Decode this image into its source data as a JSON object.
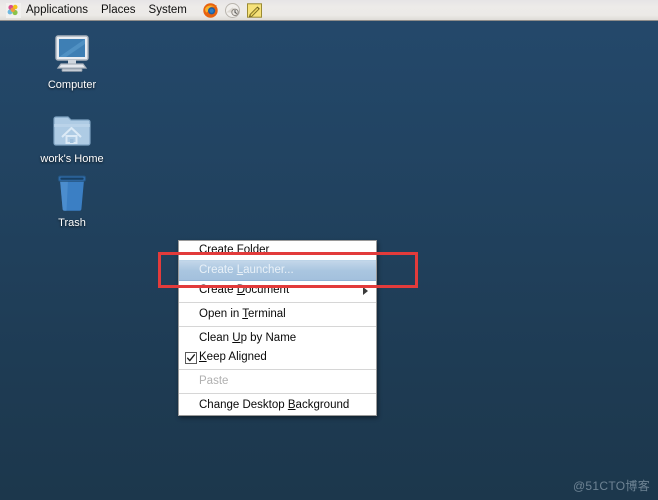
{
  "panel": {
    "apps_icon": "gnome-foot-icon",
    "menus": [
      {
        "label": "Applications"
      },
      {
        "label": "Places"
      },
      {
        "label": "System"
      }
    ],
    "launchers": [
      {
        "name": "firefox-icon",
        "title": "Firefox Web Browser"
      },
      {
        "name": "software-update-icon",
        "title": "Software Update"
      },
      {
        "name": "notes-editor-icon",
        "title": "Text Editor"
      }
    ]
  },
  "desktop": {
    "icons": [
      {
        "label": "Computer",
        "icon": "computer-icon"
      },
      {
        "label": "work's Home",
        "icon": "home-folder-icon"
      },
      {
        "label": "Trash",
        "icon": "trash-icon"
      }
    ]
  },
  "context_menu": {
    "items": [
      {
        "label": "Create Folder",
        "mnemonic": "F",
        "state": "normal",
        "submenu": false
      },
      {
        "label": "Create Launcher...",
        "mnemonic": "L",
        "state": "selected",
        "submenu": false
      },
      {
        "label": "Create Document",
        "mnemonic": "D",
        "state": "normal",
        "submenu": true
      },
      {
        "label": "Open in Terminal",
        "mnemonic": "T",
        "state": "normal",
        "submenu": false
      },
      {
        "label": "Clean Up by Name",
        "mnemonic": "U",
        "state": "normal",
        "submenu": false
      },
      {
        "label": "Keep Aligned",
        "mnemonic": "K",
        "state": "normal",
        "submenu": false,
        "checkbox": true,
        "checked": true
      },
      {
        "label": "Paste",
        "mnemonic": "",
        "state": "disabled",
        "submenu": false
      },
      {
        "label": "Change Desktop Background",
        "mnemonic": "B",
        "state": "normal",
        "submenu": false
      }
    ]
  },
  "annotation": {
    "highlight_color": "#e23b3b",
    "target_item": "Create Launcher..."
  },
  "watermark": {
    "text": "@51CTO博客"
  },
  "colors": {
    "desktop_top": "#24496c",
    "desktop_bottom": "#1c374c",
    "panel_bg": "#ebeae8",
    "menu_bg": "#ffffff",
    "selection": "#aac6e0",
    "annotation": "#e23b3b"
  }
}
